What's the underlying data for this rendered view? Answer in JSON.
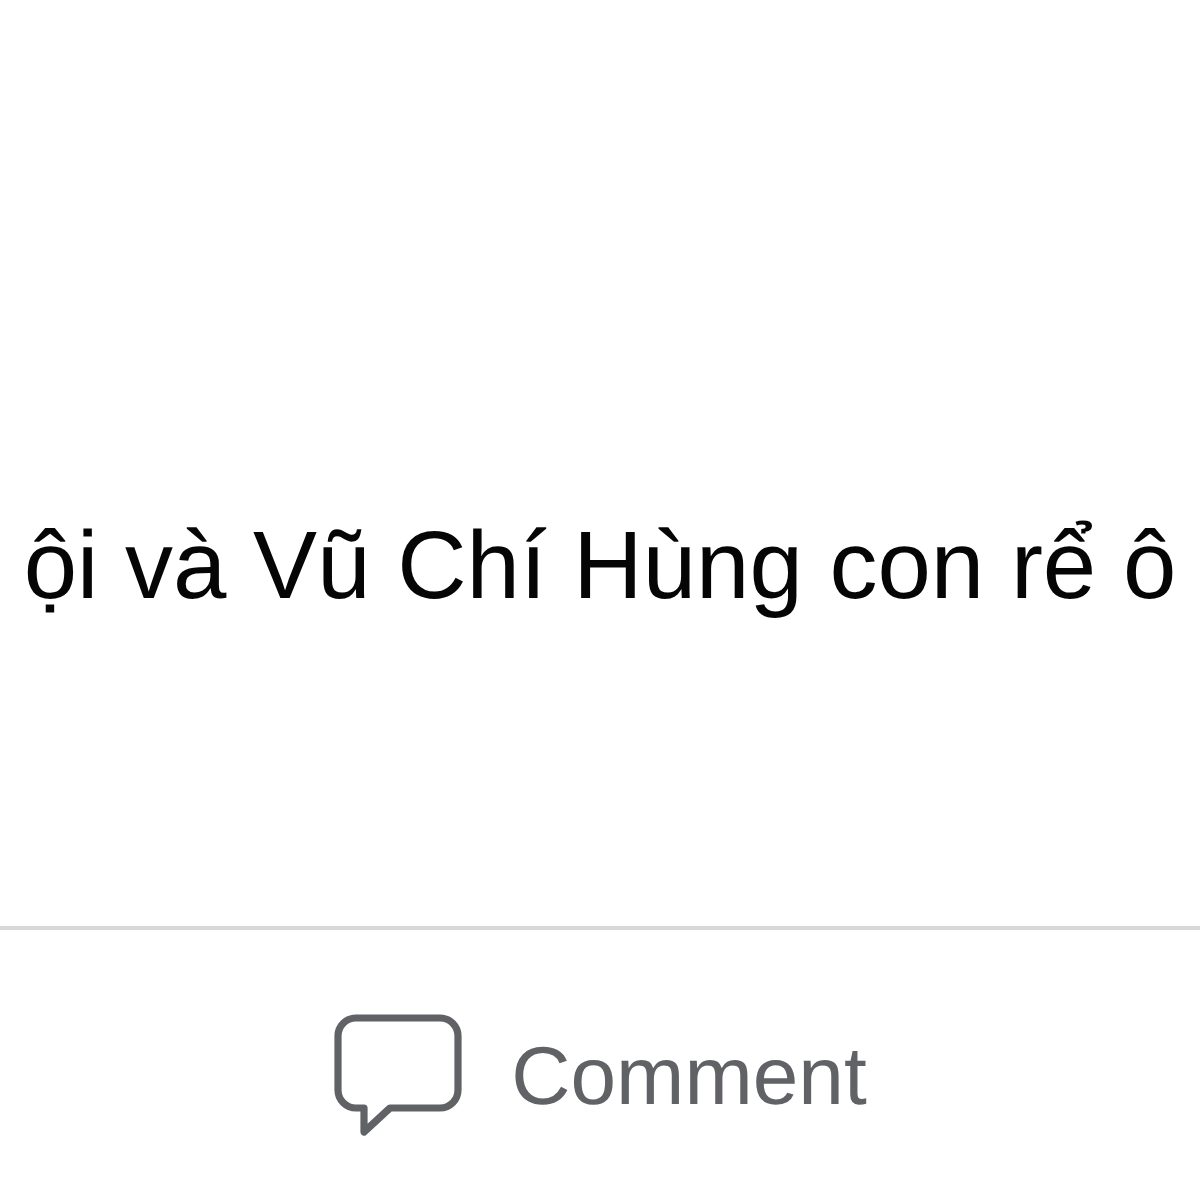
{
  "post": {
    "text": "ội và Vũ Chí Hùng con rể ô"
  },
  "actions": [
    {
      "kind": "comment",
      "label": "Comment"
    }
  ]
}
